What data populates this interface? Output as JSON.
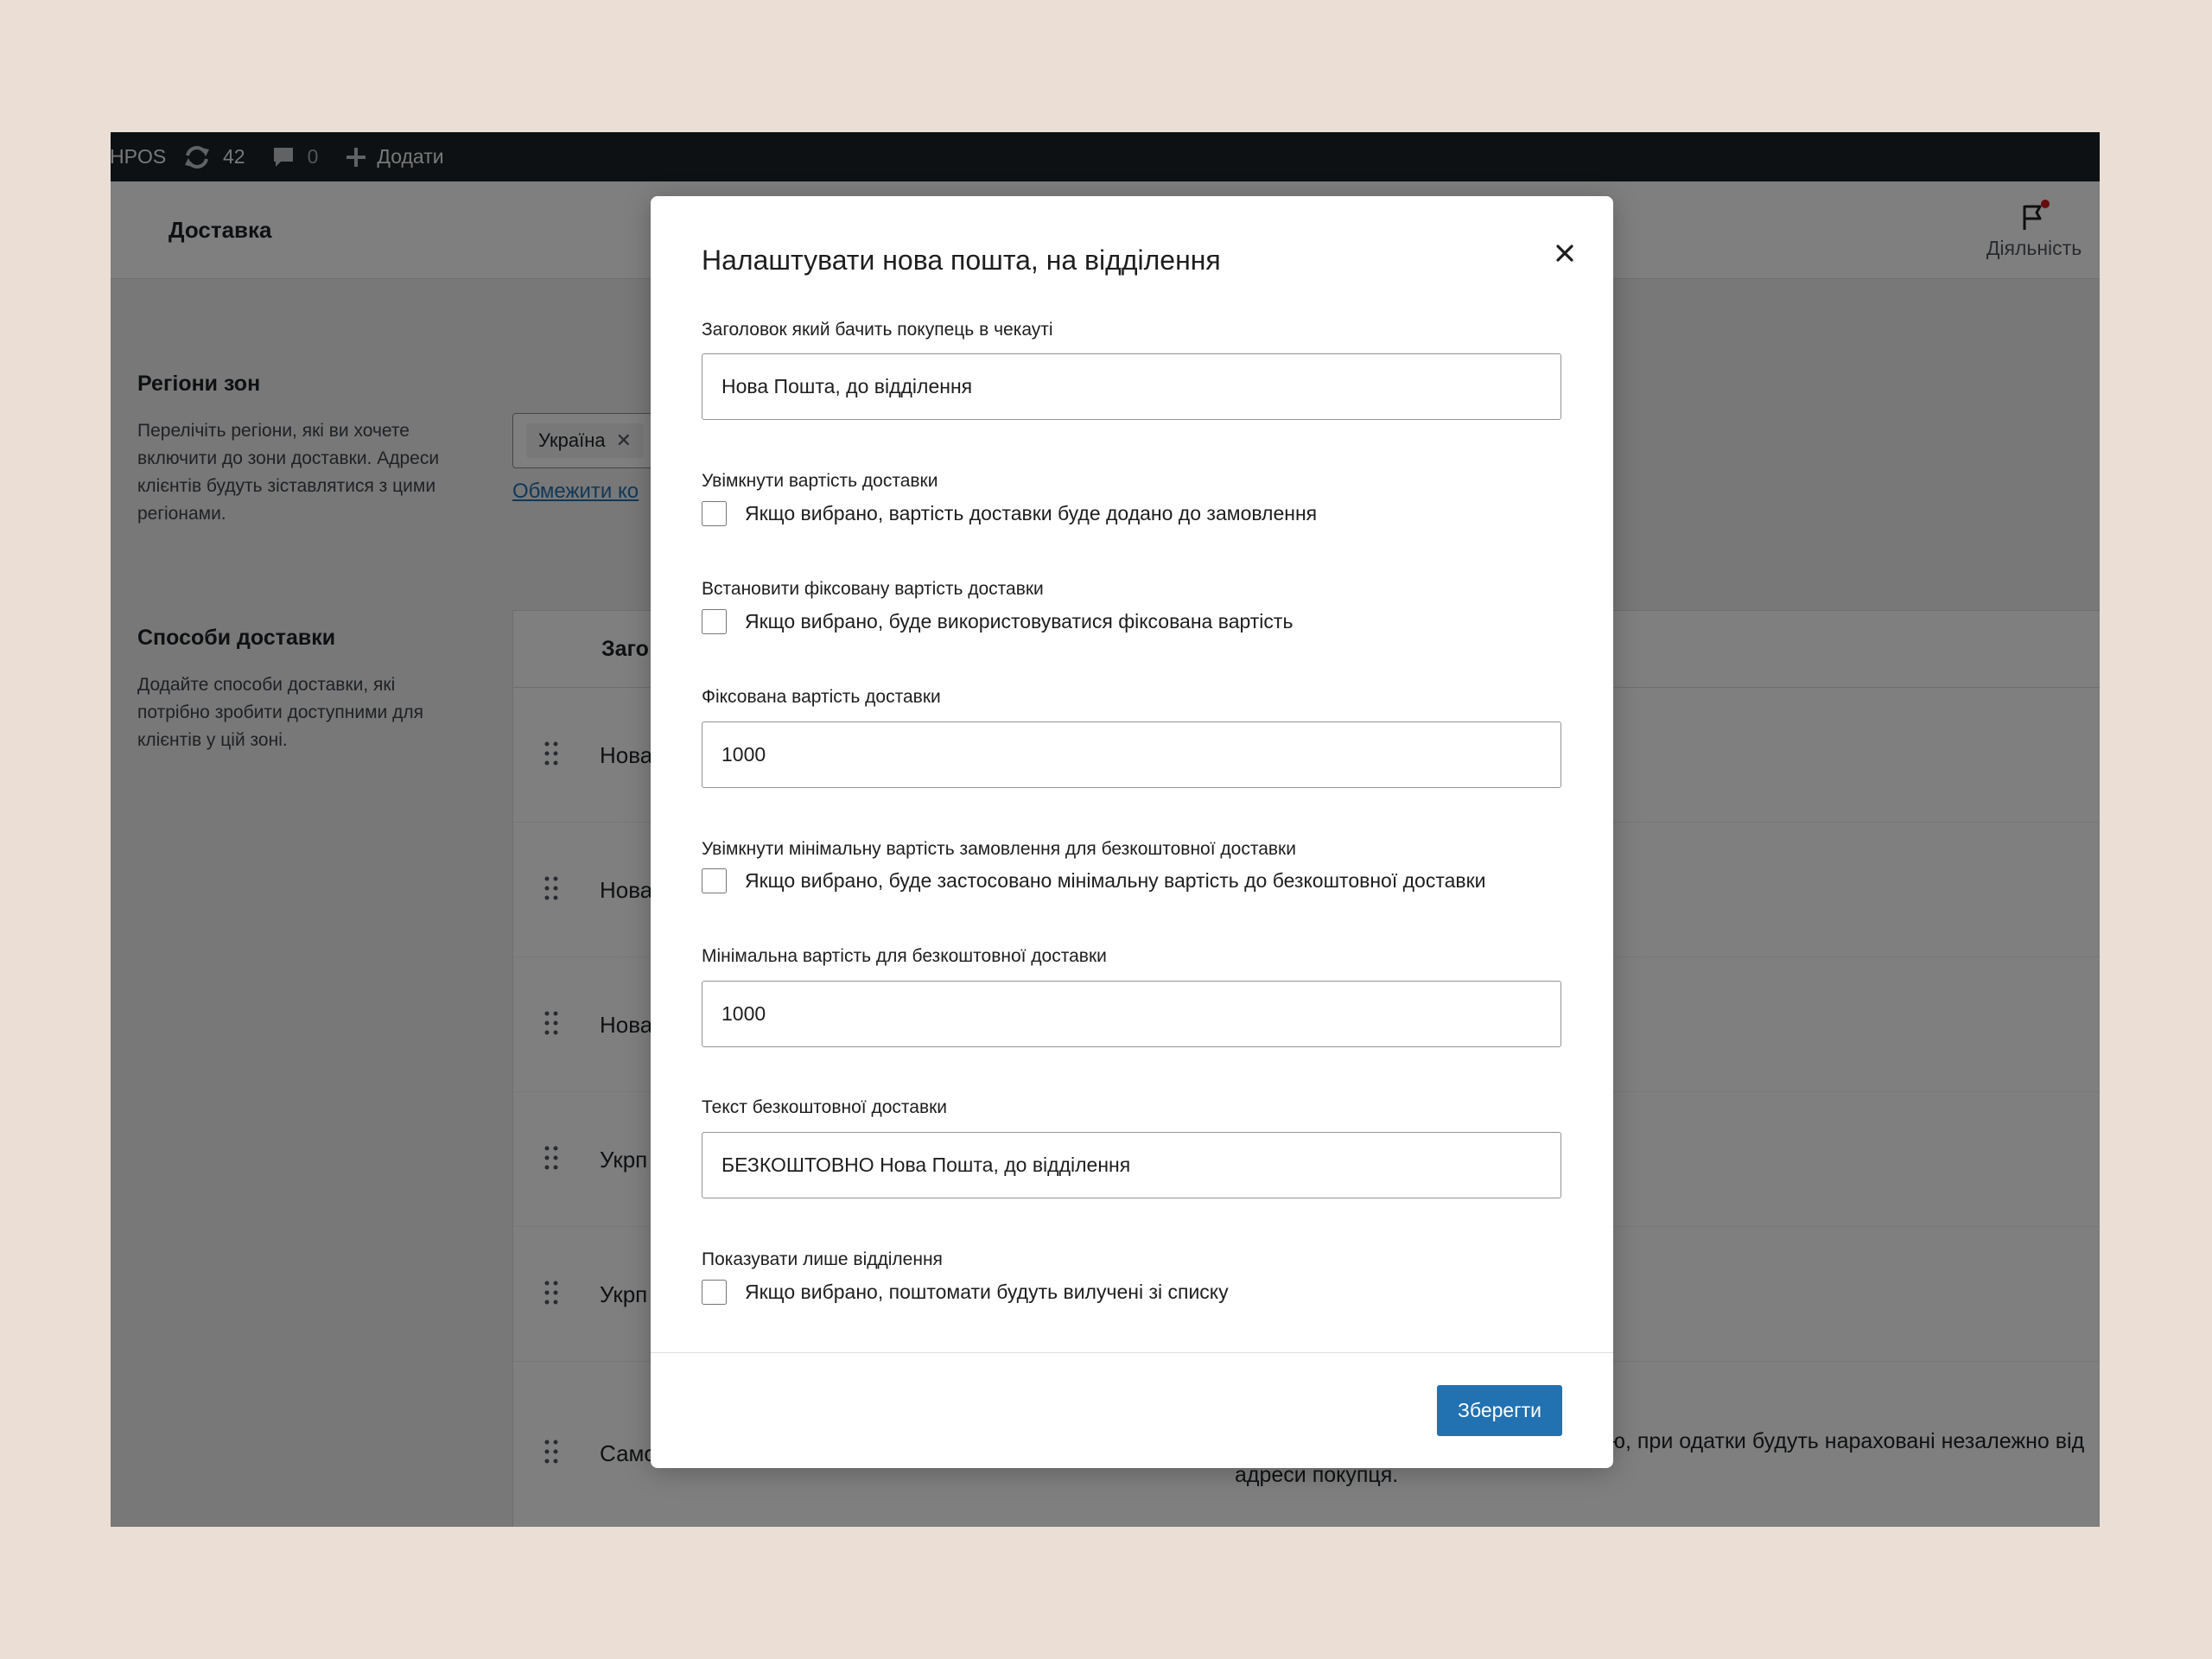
{
  "adminbar": {
    "site_label": "HPOS",
    "updates_count": "42",
    "comments_count": "0",
    "add_label": "Додати"
  },
  "header": {
    "title": "Доставка",
    "activity_label": "Діяльність"
  },
  "regions": {
    "title": "Регіони зон",
    "description": "Перелічіть регіони, які ви хочете включити до зони доставки. Адреси клієнтів будуть зіставлятися з цими регіонами.",
    "selected_region": "Україна",
    "limit_link": "Обмежити ко"
  },
  "methods": {
    "title": "Способи доставки",
    "description": "Додайте способи доставки, які потрібно зробити доступними для клієнтів у цій зоні.",
    "column_title": "Заго",
    "rows": [
      {
        "name": "Нова"
      },
      {
        "name": "Нова"
      },
      {
        "name": "Нова"
      },
      {
        "name": "Укрп"
      },
      {
        "name": "Укрп"
      },
      {
        "name": "Само"
      }
    ],
    "last_row_desc": "овлення самостійно. По замовчуванню, при одатки будуть нараховані незалежно від адреси покупця."
  },
  "modal": {
    "title": "Налаштувати нова пошта, на відділення",
    "fields": {
      "checkout_title": {
        "label": "Заголовок який бачить покупець в чекауті",
        "value": "Нова Пошта, до відділення"
      },
      "enable_cost": {
        "label": "Увімкнути вартість доставки",
        "checkbox_text": "Якщо вибрано, вартість доставки буде додано до замовлення"
      },
      "fixed_cost_toggle": {
        "label": "Встановити фіксовану вартість доставки",
        "checkbox_text": "Якщо вибрано, буде використовуватися фіксована вартість"
      },
      "fixed_cost": {
        "label": "Фіксована вартість доставки",
        "value": "1000"
      },
      "min_free_toggle": {
        "label": "Увімкнути мінімальну вартість замовлення для безкоштовної доставки",
        "checkbox_text": "Якщо вибрано, буде застосовано мінімальну вартість до безкоштовної доставки"
      },
      "min_free_value": {
        "label": "Мінімальна вартість для безкоштовної доставки",
        "value": "1000"
      },
      "free_text": {
        "label": "Текст безкоштовної доставки",
        "value": "БЕЗКОШТОВНО Нова Пошта, до відділення"
      },
      "branches_only": {
        "label": "Показувати лише відділення",
        "checkbox_text": "Якщо вибрано, поштомати будуть вилучені зі списку"
      }
    },
    "save_label": "Зберегти"
  },
  "colors": {
    "adminbar_bg": "#1d2327",
    "accent": "#2271b1",
    "page_bg": "#ebded4"
  }
}
